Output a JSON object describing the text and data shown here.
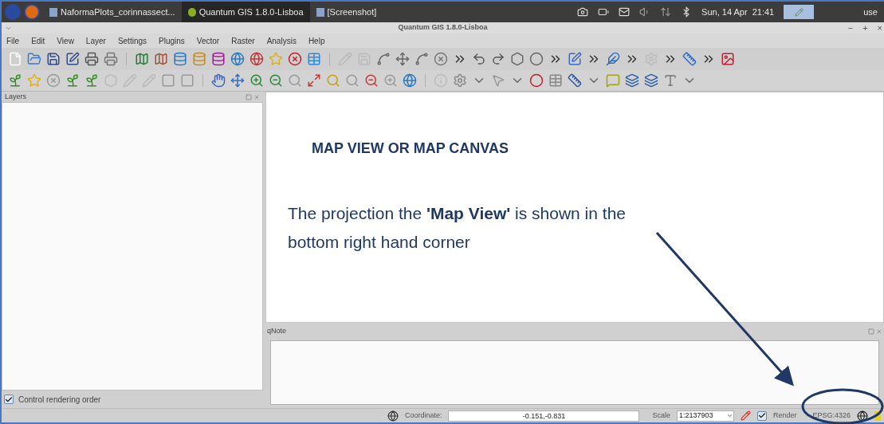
{
  "taskbar": {
    "tasks": [
      {
        "label": "NaformaPlots_corinnassect...",
        "selected": false
      },
      {
        "label": "Quantum GIS 1.8.0-Lisboa",
        "selected": true
      },
      {
        "label": "[Screenshot]",
        "selected": false
      }
    ],
    "clock": "Sun, 14 Apr  21:41",
    "user": "use"
  },
  "window": {
    "title": "Quantum GIS 1.8.0-Lisboa",
    "controls": [
      "−",
      "+",
      "×"
    ]
  },
  "menu": [
    "File",
    "Edit",
    "View",
    "Layer",
    "Settings",
    "Plugins",
    "Vector",
    "Raster",
    "Analysis",
    "Help"
  ],
  "layers_panel": {
    "title": "Layers",
    "control_rendering_order": {
      "label": "Control rendering order",
      "checked": true
    }
  },
  "map_canvas": {
    "heading": "MAP VIEW OR MAP CANVAS",
    "note": "The projection the **'Map View'** is shown in the bottom right hand corner"
  },
  "qnote_panel": {
    "title": "qNote"
  },
  "status_bar": {
    "coordinate_label": "Coordinate:",
    "coordinate": "-0.151,-0.831",
    "scale_label": "Scale",
    "scale": "1:2137903",
    "render": {
      "label": "Render",
      "checked": true
    },
    "crs": "EPSG:4326"
  }
}
